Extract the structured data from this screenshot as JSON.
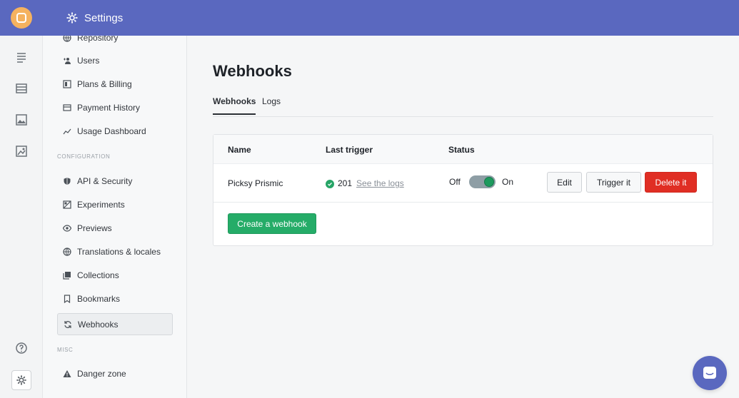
{
  "topbar": {
    "title": "Settings",
    "icon": "gear-icon"
  },
  "rail": {
    "items": [
      "document-list-icon",
      "table-icon",
      "image-icon",
      "image-edit-icon"
    ],
    "help_icon": "help-icon",
    "settings_icon": "gear-icon"
  },
  "sidebar": {
    "items_top": [
      {
        "label": "Repository",
        "icon": "globe-icon"
      },
      {
        "label": "Users",
        "icon": "add-user-icon"
      },
      {
        "label": "Plans & Billing",
        "icon": "plans-icon"
      },
      {
        "label": "Payment History",
        "icon": "card-icon"
      },
      {
        "label": "Usage Dashboard",
        "icon": "chart-icon"
      }
    ],
    "section_config": "CONFIGURATION",
    "items_config": [
      {
        "label": "API & Security",
        "icon": "shield-icon"
      },
      {
        "label": "Experiments",
        "icon": "experiment-icon"
      },
      {
        "label": "Previews",
        "icon": "eye-icon"
      },
      {
        "label": "Translations & locales",
        "icon": "globe-icon"
      },
      {
        "label": "Collections",
        "icon": "collection-icon"
      },
      {
        "label": "Bookmarks",
        "icon": "bookmark-icon"
      },
      {
        "label": "Webhooks",
        "icon": "refresh-icon",
        "active": true
      }
    ],
    "section_misc": "MISC",
    "items_misc": [
      {
        "label": "Danger zone",
        "icon": "warning-icon"
      }
    ]
  },
  "main": {
    "title": "Webhooks",
    "tabs": [
      {
        "label": "Webhooks",
        "active": true
      },
      {
        "label": "Logs",
        "active": false
      }
    ],
    "table": {
      "headers": {
        "name": "Name",
        "last_trigger": "Last trigger",
        "status": "Status"
      },
      "rows": [
        {
          "name": "Picksy Prismic",
          "status_code": "201",
          "logs_link": "See the logs",
          "toggle_off": "Off",
          "toggle_on": "On",
          "enabled": true,
          "edit": "Edit",
          "trigger": "Trigger it",
          "delete": "Delete it"
        }
      ]
    },
    "create_button": "Create a webhook"
  },
  "colors": {
    "brand": "#5a68bf",
    "success": "#25ac68",
    "danger": "#e02e24",
    "logo": "#f5b25f"
  }
}
